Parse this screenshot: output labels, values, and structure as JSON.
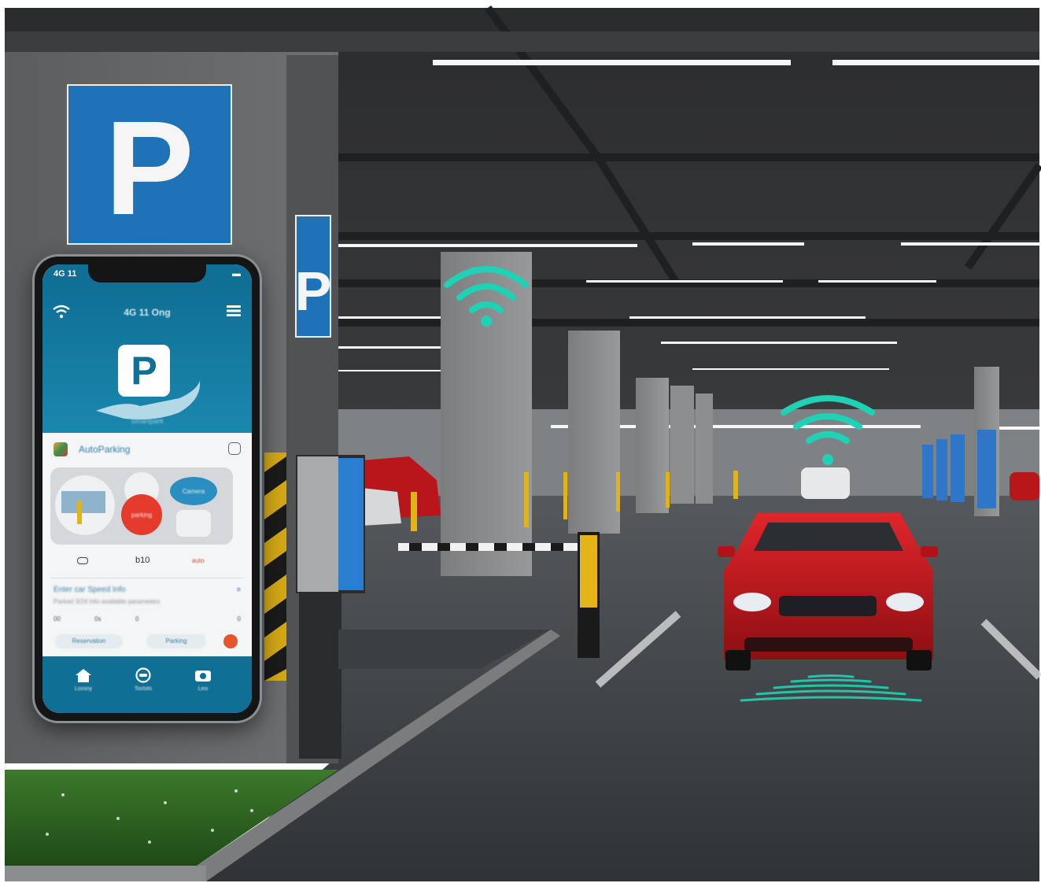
{
  "scene": {
    "big_sign_letter": "P",
    "small_sign_letter": "P",
    "accent_color": "#1fd2b5",
    "sign_blue": "#1e73b8",
    "car_color": "#c4141b"
  },
  "phone": {
    "status_left": "4G 11",
    "status_right": "▬",
    "app_title": "4G 11 Ong",
    "hero_letter": "P",
    "hero_subtitle": "Smartpark",
    "card_title": "AutoParking",
    "map_bubble_left": "parking",
    "map_bubble_right": "Camera",
    "stat_value": "b10",
    "stat_right": "auto",
    "info_title": "Enter car Speed Info",
    "info_subtitle": "Parked 3/24 Info available parameters",
    "info_link": "≡",
    "meta_values": [
      "00",
      "0s",
      "0",
      "0"
    ],
    "button_a": "Reservation",
    "button_b": "Parking",
    "nav": [
      {
        "icon": "home-icon",
        "label": "Lossny"
      },
      {
        "icon": "chat-icon",
        "label": "Toctots"
      },
      {
        "icon": "camera-icon",
        "label": "Lins"
      }
    ]
  }
}
